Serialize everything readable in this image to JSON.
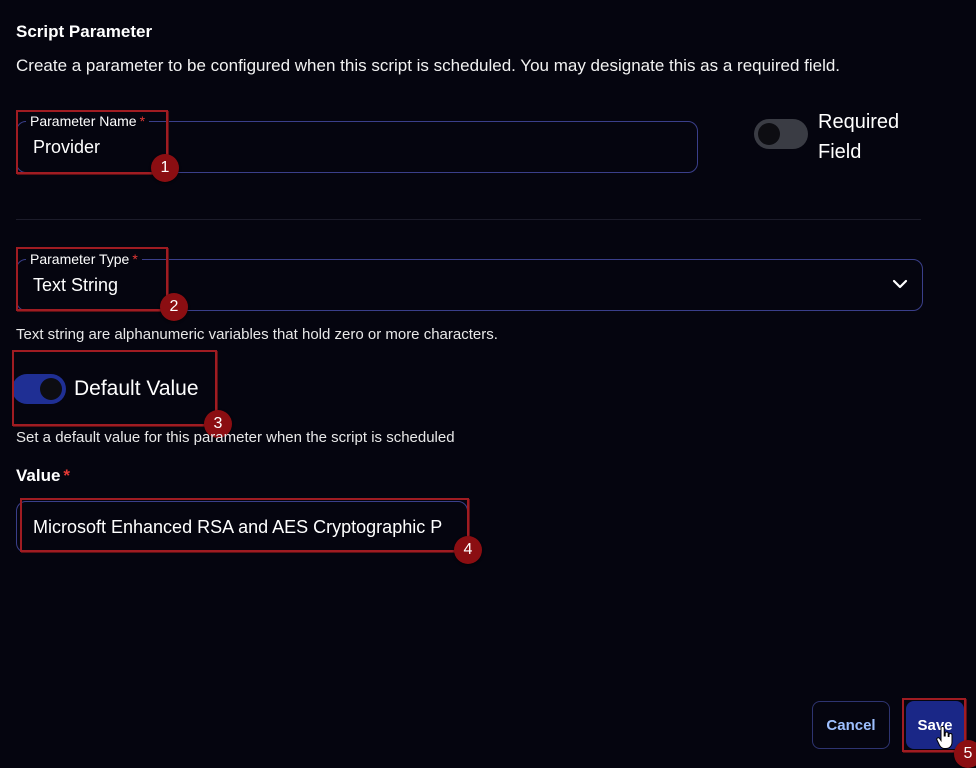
{
  "header": {
    "title": "Script Parameter",
    "description": "Create a parameter to be configured when this script is scheduled. You may designate this as a required field."
  },
  "parameter_name": {
    "label": "Parameter Name",
    "required_mark": "*",
    "value": "Provider"
  },
  "required_field": {
    "label_line1": "Required",
    "label_line2": "Field",
    "enabled": false
  },
  "parameter_type": {
    "label": "Parameter Type",
    "required_mark": "*",
    "value": "Text String",
    "helper": "Text string are alphanumeric variables that hold zero or more characters."
  },
  "default_value": {
    "label": "Default Value",
    "enabled": true,
    "helper": "Set a default value for this parameter when the script is scheduled"
  },
  "value_field": {
    "label": "Value",
    "required_mark": "*",
    "value": "Microsoft Enhanced RSA and AES Cryptographic P"
  },
  "actions": {
    "cancel_label": "Cancel",
    "save_label": "Save"
  },
  "annotations": {
    "step1": "1",
    "step2": "2",
    "step3": "3",
    "step4": "4",
    "step5": "5"
  },
  "colors": {
    "background": "#05050f",
    "accent": "#1a2787",
    "field_border": "#3a3f8a",
    "required": "#e53935",
    "annotation": "#8b0e12"
  }
}
